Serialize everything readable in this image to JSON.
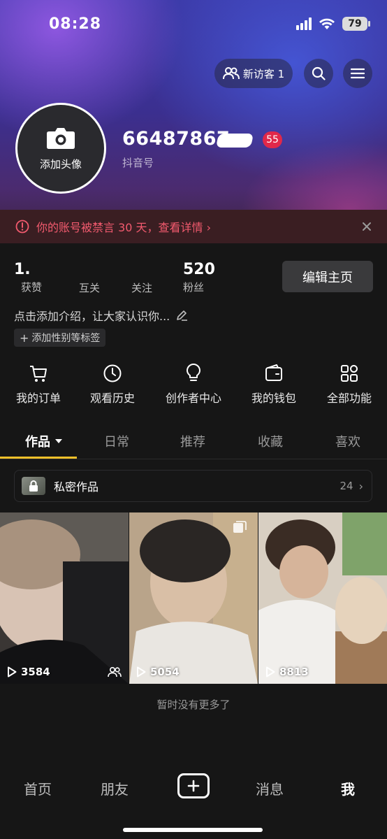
{
  "status_bar": {
    "time": "08:28",
    "battery": "79"
  },
  "header": {
    "visitors_label": "新访客 1"
  },
  "profile": {
    "avatar_label": "添加头像",
    "user_id": "66487867",
    "badge": "55",
    "id_label": "抖音号"
  },
  "notice": {
    "text": "你的账号被禁言 30 天，查看详情 ›"
  },
  "stats": [
    {
      "value": "1.",
      "label": "获赞"
    },
    {
      "value": "",
      "label": "互关"
    },
    {
      "value": "",
      "label": "关注"
    },
    {
      "value": "520",
      "label": "粉丝"
    }
  ],
  "edit_button": "编辑主页",
  "bio": {
    "text": "点击添加介绍，让大家认识你...",
    "tag_button": "添加性别等标签"
  },
  "functions": [
    {
      "label": "我的订单",
      "icon": "cart-icon"
    },
    {
      "label": "观看历史",
      "icon": "clock-icon"
    },
    {
      "label": "创作者中心",
      "icon": "lightbulb-icon"
    },
    {
      "label": "我的钱包",
      "icon": "wallet-icon"
    },
    {
      "label": "全部功能",
      "icon": "grid-icon"
    }
  ],
  "tabs": [
    {
      "label": "作品",
      "active": true
    },
    {
      "label": "日常"
    },
    {
      "label": "推荐"
    },
    {
      "label": "收藏"
    },
    {
      "label": "喜欢"
    }
  ],
  "private_works": {
    "label": "私密作品",
    "count": "24"
  },
  "videos": [
    {
      "plays": "3584"
    },
    {
      "plays": "5054"
    },
    {
      "plays": "8813"
    }
  ],
  "footer_text": "暂时没有更多了",
  "bottom_nav": [
    {
      "label": "首页"
    },
    {
      "label": "朋友"
    },
    {
      "label": "消息"
    },
    {
      "label": "我",
      "active": true
    }
  ],
  "colors": {
    "accent": "#f5c12a",
    "alert": "#f25a6e",
    "badge": "#e0284a"
  }
}
